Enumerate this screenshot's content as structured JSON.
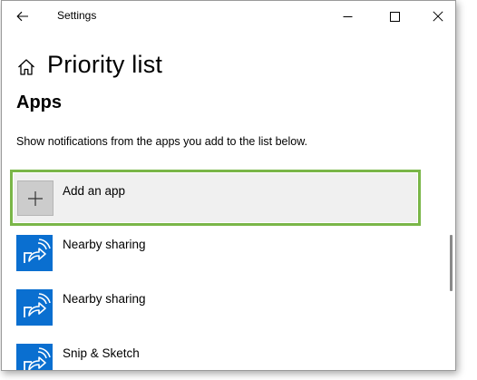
{
  "window": {
    "title": "Settings"
  },
  "icons": {
    "back": "back-arrow-icon",
    "minimize": "minimize-icon",
    "maximize": "maximize-icon",
    "close": "close-icon",
    "home": "home-icon",
    "add": "plus-icon",
    "app": "share-icon"
  },
  "colors": {
    "highlight": "#7ab648",
    "app_tile": "#0a6fd0",
    "add_tile_bg": "#f0f0f0"
  },
  "page": {
    "title": "Priority list",
    "section": "Apps",
    "description": "Show notifications from the apps you add to the list below."
  },
  "add_app": {
    "label": "Add an app"
  },
  "apps": [
    {
      "label": "Nearby sharing"
    },
    {
      "label": "Nearby sharing"
    },
    {
      "label": "Snip & Sketch"
    }
  ]
}
